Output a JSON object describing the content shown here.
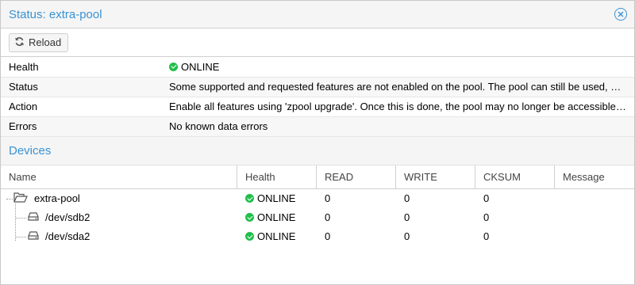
{
  "window": {
    "title": "Status: extra-pool",
    "close_icon": "close-circle-icon",
    "accent": "#3892d4"
  },
  "toolbar": {
    "reload_label": "Reload",
    "reload_icon": "refresh-icon"
  },
  "status": {
    "rows": [
      {
        "key": "Health",
        "value": "ONLINE",
        "icon": "check-circle-icon"
      },
      {
        "key": "Status",
        "value": "Some supported and requested features are not enabled on the pool. The pool can still be used, but some features are unavailable."
      },
      {
        "key": "Action",
        "value": "Enable all features using 'zpool upgrade'. Once this is done, the pool may no longer be accessible by software that does not support the features."
      },
      {
        "key": "Errors",
        "value": "No known data errors"
      }
    ],
    "ok_color": "#21bf4b"
  },
  "devices": {
    "title": "Devices",
    "columns": [
      "Name",
      "Health",
      "READ",
      "WRITE",
      "CKSUM",
      "Message"
    ],
    "rows": [
      {
        "name": "extra-pool",
        "icon": "folder-open-icon",
        "health": "ONLINE",
        "read": "0",
        "write": "0",
        "cksum": "0",
        "message": ""
      },
      {
        "name": "/dev/sdb2",
        "icon": "disk-icon",
        "health": "ONLINE",
        "read": "0",
        "write": "0",
        "cksum": "0",
        "message": ""
      },
      {
        "name": "/dev/sda2",
        "icon": "disk-icon",
        "health": "ONLINE",
        "read": "0",
        "write": "0",
        "cksum": "0",
        "message": ""
      }
    ]
  }
}
